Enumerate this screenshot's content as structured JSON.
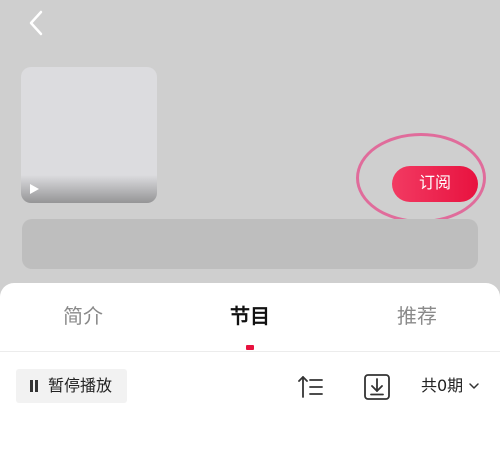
{
  "header": {
    "back_icon": "chevron-left-icon",
    "subscribe_label": "订阅",
    "colors": {
      "header_bg": "#cfcfcf",
      "accent": "#e8123f",
      "highlight_ring": "#e06c9b"
    }
  },
  "tabs": [
    {
      "label": "简介",
      "active": false
    },
    {
      "label": "节目",
      "active": true
    },
    {
      "label": "推荐",
      "active": false
    }
  ],
  "toolbar": {
    "pause_label": "暂停播放",
    "pause_icon": "pause-icon",
    "sort_icon": "sort-icon",
    "download_icon": "download-icon",
    "episode_count_label": "共0期",
    "dropdown_icon": "chevron-down-icon"
  }
}
